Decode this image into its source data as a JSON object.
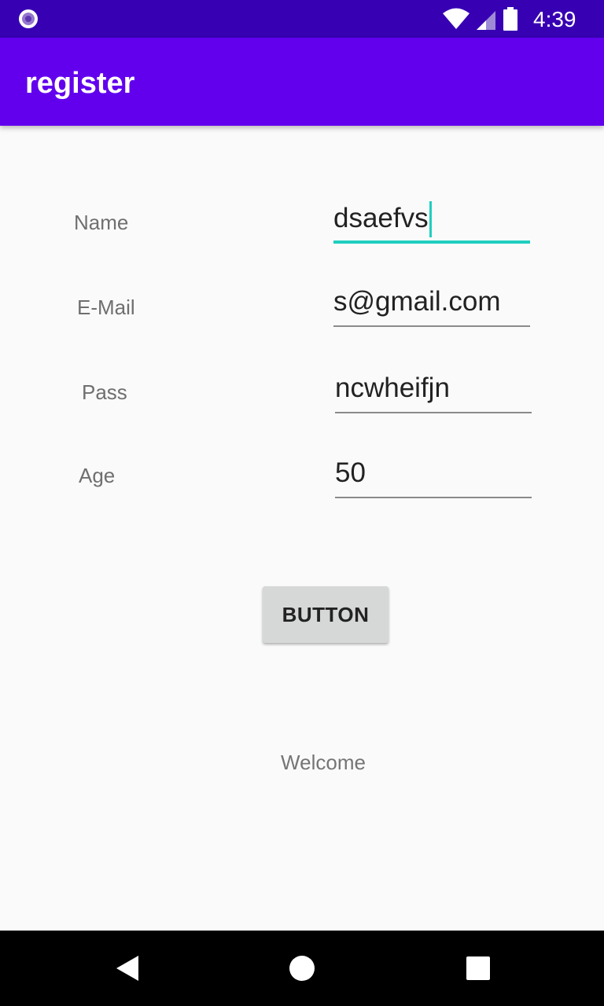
{
  "status_bar": {
    "time": "4:39",
    "icons": [
      "notification-circle-icon",
      "wifi-icon",
      "signal-icon",
      "battery-icon"
    ],
    "background": "#3700b3"
  },
  "app_bar": {
    "title": "register",
    "background": "#6200ee"
  },
  "form": {
    "name": {
      "label": "Name",
      "value": "dsaefvs"
    },
    "email": {
      "label": "E-Mail",
      "value": "s@gmail.com"
    },
    "pass": {
      "label": "Pass",
      "value": "ncwheifjn"
    },
    "age": {
      "label": "Age",
      "value": "50"
    }
  },
  "button": {
    "label": "BUTTON"
  },
  "welcome_text": "Welcome",
  "nav_bar": {
    "icons": [
      "back-icon",
      "home-icon",
      "recents-icon"
    ]
  },
  "colors": {
    "accent": "#1fcec0"
  }
}
